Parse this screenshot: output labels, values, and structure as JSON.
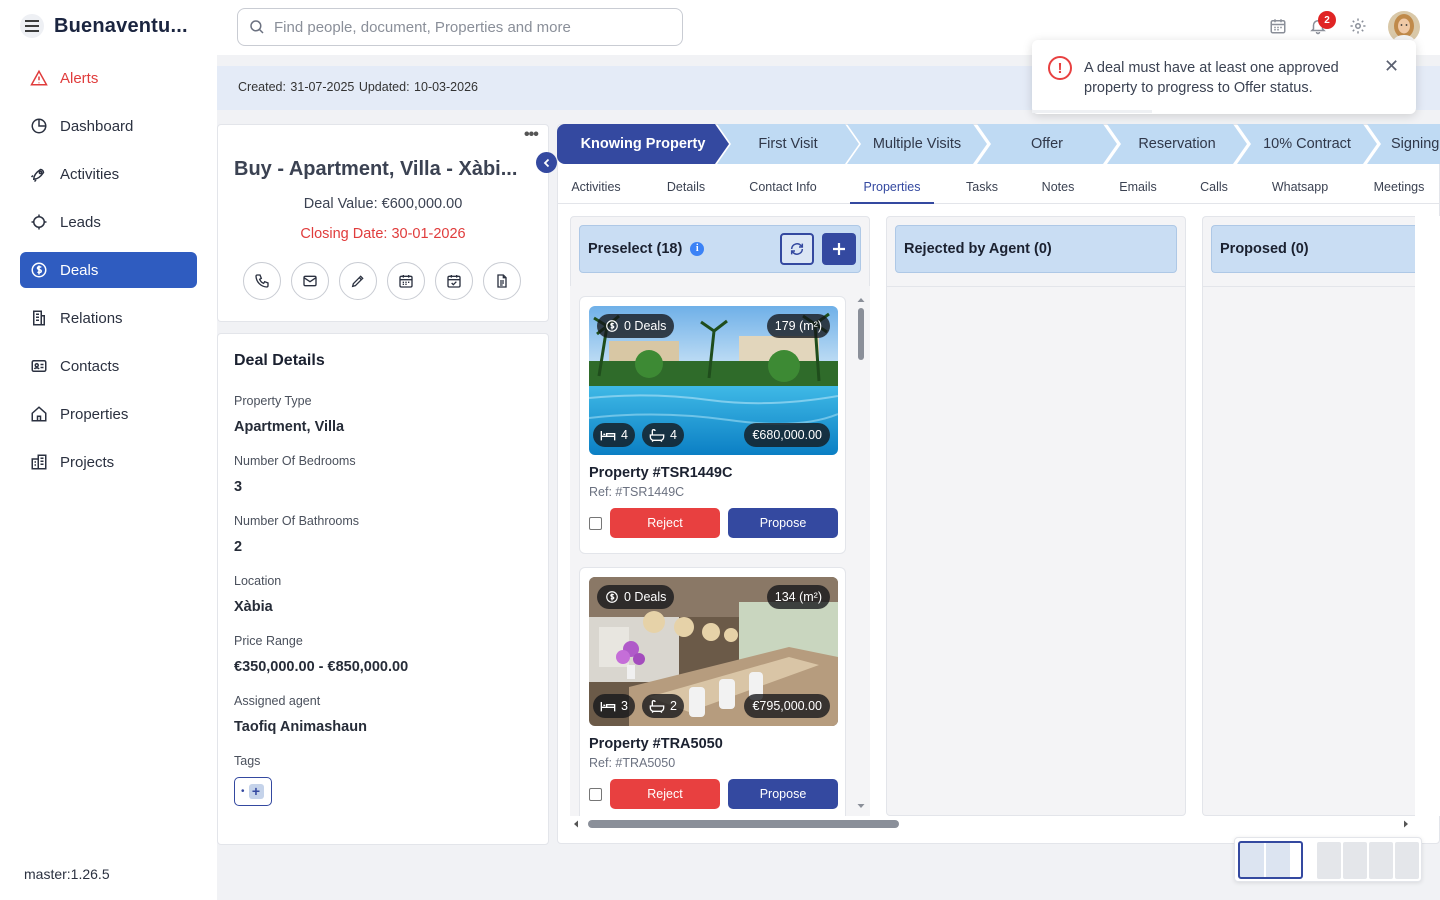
{
  "app": {
    "name": "Buenaventu...",
    "version": "master:1.26.5"
  },
  "sidebar": {
    "items": [
      {
        "label": "Alerts",
        "icon": "alert-triangle-icon"
      },
      {
        "label": "Dashboard",
        "icon": "pie-chart-icon"
      },
      {
        "label": "Activities",
        "icon": "rocket-icon"
      },
      {
        "label": "Leads",
        "icon": "target-icon"
      },
      {
        "label": "Deals",
        "icon": "dollar-circle-icon"
      },
      {
        "label": "Relations",
        "icon": "building-icon"
      },
      {
        "label": "Contacts",
        "icon": "id-card-icon"
      },
      {
        "label": "Properties",
        "icon": "home-icon"
      },
      {
        "label": "Projects",
        "icon": "city-icon"
      }
    ],
    "active": "Deals"
  },
  "topbar": {
    "search_placeholder": "Find people, document, Properties and more",
    "notification_count": "2"
  },
  "infobar": {
    "text": "Created: 31-07-2025   Updated: 10-03-2026"
  },
  "toast": {
    "message": "A deal must have at least one approved property to progress to Offer status.",
    "close": "✕"
  },
  "deal": {
    "title": "Buy - Apartment, Villa - Xàbi...",
    "value": "Deal Value:  €600,000.00",
    "closing": "Closing Date: 30-01-2026",
    "more": "•••"
  },
  "details": {
    "heading": "Deal Details",
    "fields": [
      {
        "label": "Property Type",
        "value": "Apartment, Villa"
      },
      {
        "label": "Number Of Bedrooms",
        "value": "3"
      },
      {
        "label": "Number Of Bathrooms",
        "value": "2"
      },
      {
        "label": "Location",
        "value": "Xàbia"
      },
      {
        "label": "Price Range",
        "value": "€350,000.00 - €850,000.00"
      },
      {
        "label": "Assigned agent",
        "value": "Taofiq Animashaun"
      },
      {
        "label": "Tags",
        "value": ""
      }
    ]
  },
  "stages": [
    "Knowing Property",
    "First Visit",
    "Multiple Visits",
    "Offer",
    "Reservation",
    "10% Contract",
    "Signing"
  ],
  "tabs": [
    "Activities",
    "Details",
    "Contact Info",
    "Properties",
    "Tasks",
    "Notes",
    "Emails",
    "Calls",
    "Whatsapp",
    "Meetings"
  ],
  "active_tab": "Properties",
  "columns": [
    {
      "title": "Preselect  (18)"
    },
    {
      "title": "Rejected by Agent  (0)"
    },
    {
      "title": "Proposed  (0)"
    }
  ],
  "properties": [
    {
      "deals": "0 Deals",
      "area": "179 (m²)",
      "beds": "4",
      "baths": "4",
      "price": "€680,000.00",
      "title": "Property #TSR1449C",
      "ref": "Ref: #TSR1449C",
      "reject": "Reject",
      "propose": "Propose"
    },
    {
      "deals": "0 Deals",
      "area": "134 (m²)",
      "beds": "3",
      "baths": "2",
      "price": "€795,000.00",
      "title": "Property #TRA5050",
      "ref": "Ref: #TRA5050",
      "reject": "Reject",
      "propose": "Propose"
    }
  ],
  "colors": {
    "primary": "#3449a0",
    "danger": "#e84040",
    "stage": "#bfdaf3",
    "column_header": "#c9ddf3"
  }
}
